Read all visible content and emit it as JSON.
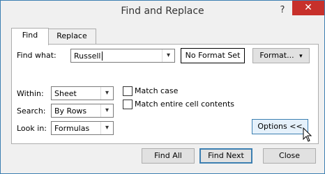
{
  "window": {
    "title": "Find and Replace",
    "help_glyph": "?",
    "close_glyph": "✕"
  },
  "tabs": [
    {
      "label": "Find",
      "selected": true
    },
    {
      "label": "Replace",
      "selected": false
    }
  ],
  "find_what": {
    "label": "Find what:",
    "value": "Russell",
    "format_status": "No Format Set",
    "format_button": "Format..."
  },
  "options": {
    "within": {
      "label": "Within:",
      "value": "Sheet"
    },
    "search": {
      "label": "Search:",
      "value": "By Rows"
    },
    "look_in": {
      "label": "Look in:",
      "value": "Formulas"
    },
    "match_case": {
      "label": "Match case",
      "checked": false
    },
    "match_entire": {
      "label": "Match entire cell contents",
      "checked": false
    },
    "options_button": "Options <<"
  },
  "footer": {
    "find_all": "Find All",
    "find_next": "Find Next",
    "close": "Close"
  },
  "colors": {
    "accent": "#3c7fb1",
    "close_red": "#c7302b"
  }
}
